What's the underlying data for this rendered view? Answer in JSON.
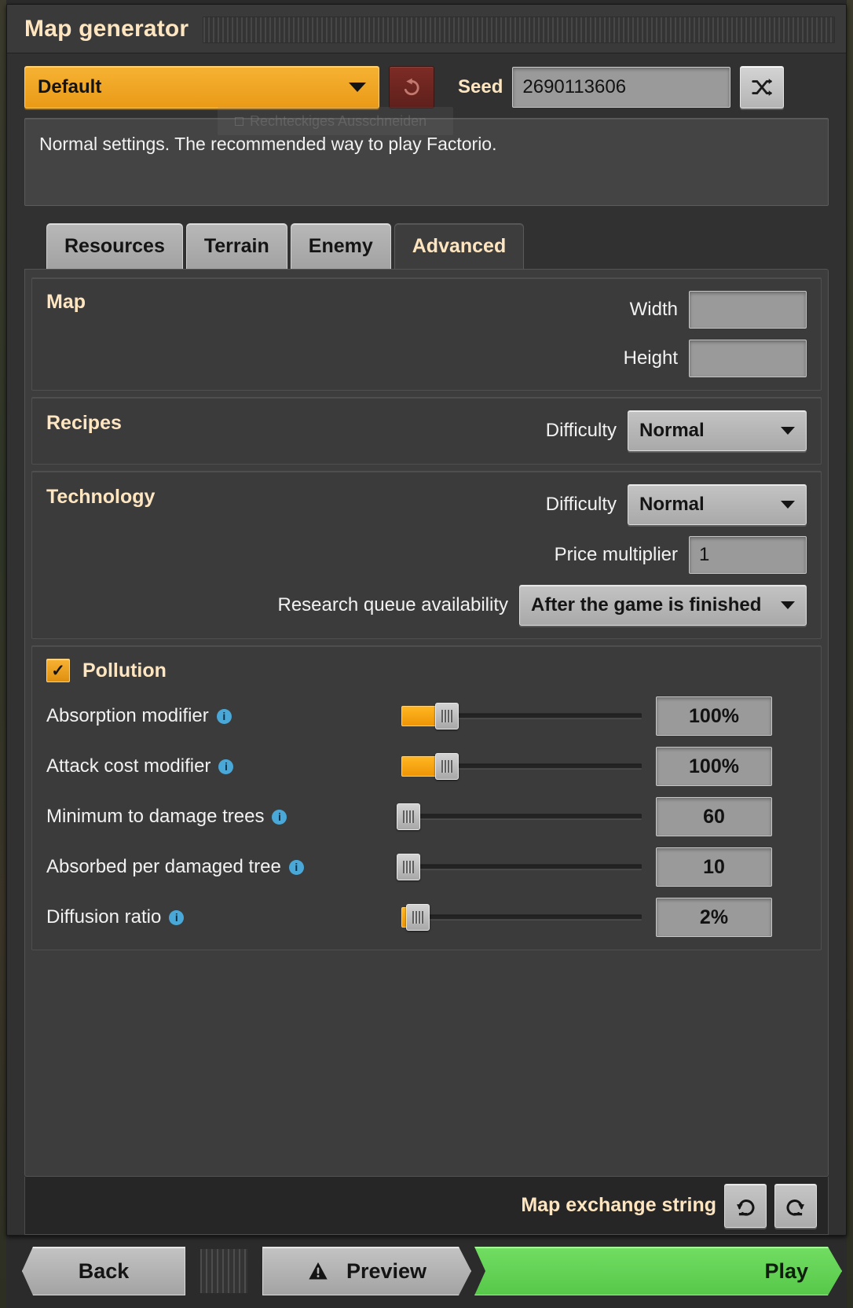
{
  "window": {
    "title": "Map generator"
  },
  "preset": {
    "selected": "Default",
    "reset_icon": "undo-icon"
  },
  "seed": {
    "label": "Seed",
    "value": "2690113606",
    "shuffle_icon": "shuffle-icon"
  },
  "description": {
    "text": "Normal settings. The recommended way to play Factorio.",
    "watermark": "Rechteckiges Ausschneiden"
  },
  "tabs": [
    {
      "label": "Resources",
      "active": false
    },
    {
      "label": "Terrain",
      "active": false
    },
    {
      "label": "Enemy",
      "active": false
    },
    {
      "label": "Advanced",
      "active": true
    }
  ],
  "map_section": {
    "title": "Map",
    "width_label": "Width",
    "width_value": "",
    "height_label": "Height",
    "height_value": ""
  },
  "recipes_section": {
    "title": "Recipes",
    "difficulty_label": "Difficulty",
    "difficulty_value": "Normal"
  },
  "technology_section": {
    "title": "Technology",
    "difficulty_label": "Difficulty",
    "difficulty_value": "Normal",
    "price_multiplier_label": "Price multiplier",
    "price_multiplier_value": "1",
    "research_queue_label": "Research queue availability",
    "research_queue_value": "After the game is finished"
  },
  "pollution_section": {
    "title": "Pollution",
    "enabled": true,
    "sliders": [
      {
        "label": "Absorption modifier",
        "value": "100%",
        "fill_pct": 19,
        "knob_pct": 19
      },
      {
        "label": "Attack cost modifier",
        "value": "100%",
        "fill_pct": 19,
        "knob_pct": 19
      },
      {
        "label": "Minimum to damage trees",
        "value": "60",
        "fill_pct": 0,
        "knob_pct": 3
      },
      {
        "label": "Absorbed per damaged tree",
        "value": "10",
        "fill_pct": 0,
        "knob_pct": 3
      },
      {
        "label": "Diffusion ratio",
        "value": "2%",
        "fill_pct": 4,
        "knob_pct": 7
      }
    ]
  },
  "exchange": {
    "label": "Map exchange string",
    "import_icon": "import-arrow-icon",
    "export_icon": "export-arrow-icon"
  },
  "footer": {
    "back_label": "Back",
    "preview_label": "Preview",
    "preview_icon": "warning-triangle-icon",
    "play_label": "Play"
  },
  "colors": {
    "accent_orange": "#f7b233",
    "title_text": "#ffe6c0",
    "play_green": "#57c84a",
    "info_blue": "#4aa8d8",
    "panel_bg": "#3b3b3b"
  }
}
